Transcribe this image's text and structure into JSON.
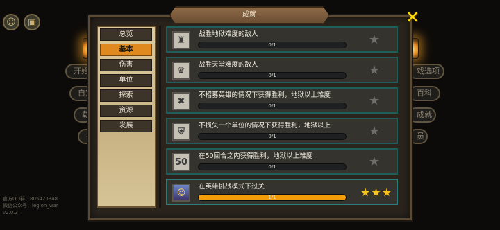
{
  "background": {
    "menu_left": [
      "开始",
      "自定",
      "载",
      "挑"
    ],
    "menu_right": [
      "戏选项",
      "百科",
      "成就",
      "员"
    ],
    "footer_lines": [
      "官方QQ群：805423348",
      "微信公众号：legion_war",
      "v2.0.3"
    ]
  },
  "panel": {
    "title": "成就",
    "close_icon": "close-x-icon"
  },
  "tabs": [
    {
      "label": "总览",
      "active": false
    },
    {
      "label": "基本",
      "active": true
    },
    {
      "label": "伤害",
      "active": false
    },
    {
      "label": "单位",
      "active": false
    },
    {
      "label": "探索",
      "active": false
    },
    {
      "label": "资源",
      "active": false
    },
    {
      "label": "发展",
      "active": false
    }
  ],
  "achievements": [
    {
      "name": "战胜地狱难度的敌人",
      "progress": "0/1",
      "fraction": 0,
      "icon": "helmet-icon",
      "completed": false
    },
    {
      "name": "战胜天堂难度的敌人",
      "progress": "0/1",
      "fraction": 0,
      "icon": "crown-icon",
      "completed": false
    },
    {
      "name": "不招募英雄的情况下获得胜利，地狱以上难度",
      "progress": "0/1",
      "fraction": 0,
      "icon": "no-hero-icon",
      "completed": false
    },
    {
      "name": "不损失一个单位的情况下获得胜利，地狱以上",
      "progress": "0/1",
      "fraction": 0,
      "icon": "shield-unit-icon",
      "completed": false
    },
    {
      "name": "在50回合之内获得胜利，地狱以上难度",
      "progress": "0/1",
      "fraction": 0,
      "icon": "fifty-turns-icon",
      "icon_text": "50",
      "completed": false
    },
    {
      "name": "在英雄挑战模式下过关",
      "progress": "1/1",
      "fraction": 1,
      "icon": "hero-portrait-icon",
      "completed": true,
      "stars": 3
    }
  ],
  "colors": {
    "accent_orange": "#f29c0c",
    "star_gold": "#f7c21c",
    "row_border": "#1f5e5a"
  }
}
